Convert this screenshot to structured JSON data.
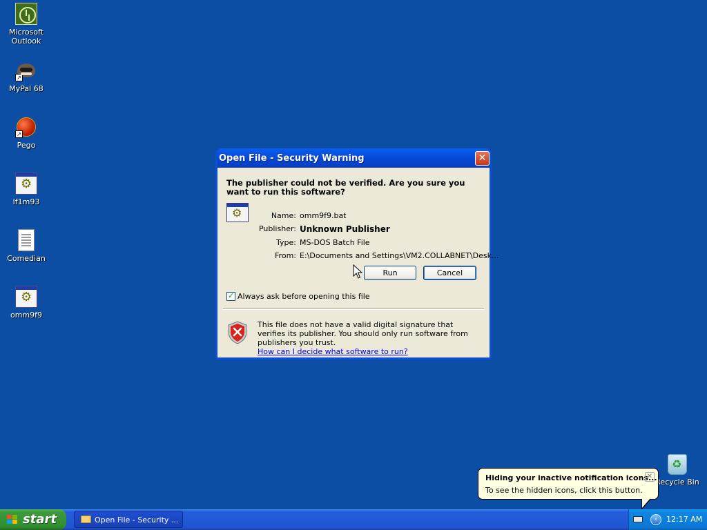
{
  "desktop": {
    "icons": [
      {
        "label": "Microsoft\nOutlook",
        "icon": "outlook-icon"
      },
      {
        "label": "MyPal 68",
        "icon": "mypal-icon"
      },
      {
        "label": "Pego",
        "icon": "pego-icon"
      },
      {
        "label": "lf1m93",
        "icon": "batch-file-icon"
      },
      {
        "label": "Comedian",
        "icon": "text-document-icon"
      },
      {
        "label": "omm9f9",
        "icon": "batch-file-icon"
      }
    ],
    "recycle_bin": {
      "label": "Recycle Bin",
      "icon": "recycle-bin-icon"
    }
  },
  "dialog": {
    "title": "Open File - Security Warning",
    "close_label": "✕",
    "question": "The publisher could not be verified.  Are you sure you want to run this software?",
    "fields": [
      {
        "key": "Name:",
        "value": "omm9f9.bat"
      },
      {
        "key": "Publisher:",
        "value": "Unknown Publisher"
      },
      {
        "key": "Type:",
        "value": "MS-DOS Batch File"
      },
      {
        "key": "From:",
        "value": "E:\\Documents and Settings\\VM2.COLLABNET\\Desk..."
      }
    ],
    "run_label": "Run",
    "cancel_label": "Cancel",
    "checkbox_label": "Always ask before opening this file",
    "checkbox_checked": true,
    "warning_text": "This file does not have a valid digital signature that verifies its publisher.  You should only run software from publishers you trust.",
    "help_link": "How can I decide what software to run?"
  },
  "taskbar": {
    "start_label": "start",
    "task_label": "Open File - Security ...",
    "clock": "12:17 AM"
  },
  "balloon": {
    "title": "Hiding your inactive notification icons...",
    "body": "To see the hidden icons, click this button.",
    "close_label": "✕"
  },
  "colors": {
    "desktop": "#0b4ea3",
    "titlebar": "#0546d0",
    "dialog_bg": "#ece9d8",
    "start_green": "#3c9a3c",
    "balloon_bg": "#ffffe1"
  }
}
